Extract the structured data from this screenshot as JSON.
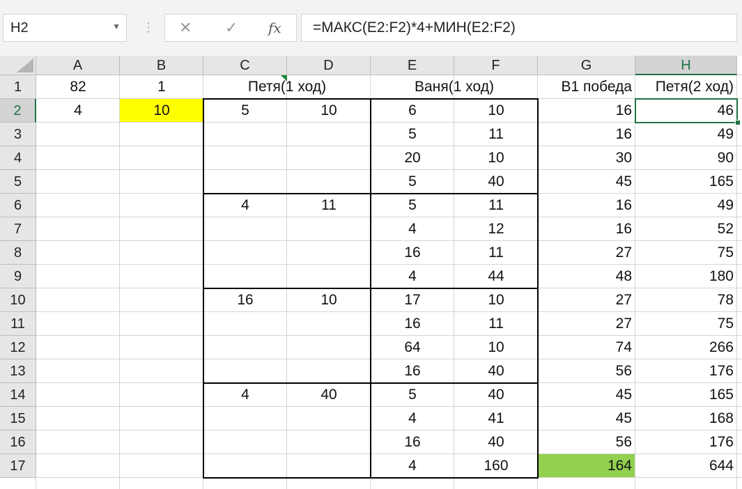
{
  "formula_bar": {
    "name_box": "H2",
    "formula": "=МАКС(E2:F2)*4+МИН(E2:F2)",
    "cancel_icon": "✕",
    "enter_icon": "✓",
    "fx_icon": "fx"
  },
  "columns": [
    "A",
    "B",
    "C",
    "D",
    "E",
    "F",
    "G",
    "H"
  ],
  "selected_column": "H",
  "rows": [
    "1",
    "2",
    "3",
    "4",
    "5",
    "6",
    "7",
    "8",
    "9",
    "10",
    "11",
    "12",
    "13",
    "14",
    "15",
    "16",
    "17"
  ],
  "selected_row": "2",
  "colors": {
    "selection": "#217346",
    "yellow_fill": "#ffff00",
    "green_fill": "#92d050"
  },
  "cells": {
    "A1": "82",
    "B1": "1",
    "C1": "Петя(1 ход)",
    "E1": "Ваня(1 ход)",
    "G1": "В1 победа",
    "H1": "Петя(2 ход)",
    "A2": "4",
    "B2": "10",
    "C2": "5",
    "D2": "10",
    "E2": "6",
    "F2": "10",
    "G2": "16",
    "H2": "46",
    "E3": "5",
    "F3": "11",
    "G3": "16",
    "H3": "49",
    "E4": "20",
    "F4": "10",
    "G4": "30",
    "H4": "90",
    "E5": "5",
    "F5": "40",
    "G5": "45",
    "H5": "165",
    "C6": "4",
    "D6": "11",
    "E6": "5",
    "F6": "11",
    "G6": "16",
    "H6": "49",
    "E7": "4",
    "F7": "12",
    "G7": "16",
    "H7": "52",
    "E8": "16",
    "F8": "11",
    "G8": "27",
    "H8": "75",
    "E9": "4",
    "F9": "44",
    "G9": "48",
    "H9": "180",
    "C10": "16",
    "D10": "10",
    "E10": "17",
    "F10": "10",
    "G10": "27",
    "H10": "78",
    "E11": "16",
    "F11": "11",
    "G11": "27",
    "H11": "75",
    "E12": "64",
    "F12": "10",
    "G12": "74",
    "H12": "266",
    "E13": "16",
    "F13": "40",
    "G13": "56",
    "H13": "176",
    "C14": "4",
    "D14": "40",
    "E14": "5",
    "F14": "40",
    "G14": "45",
    "H14": "165",
    "E15": "4",
    "F15": "41",
    "G15": "45",
    "H15": "168",
    "E16": "16",
    "F16": "40",
    "G16": "56",
    "H16": "176",
    "E17": "4",
    "F17": "160",
    "G17": "164",
    "H17": "644"
  }
}
